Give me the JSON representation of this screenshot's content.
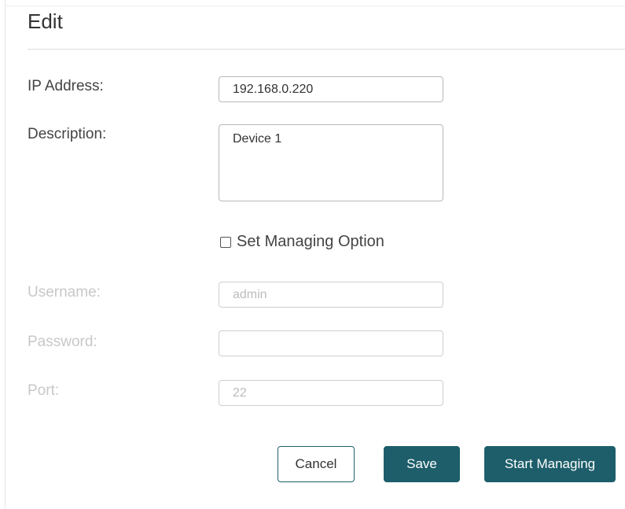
{
  "dialog": {
    "title": "Edit"
  },
  "form": {
    "ip_address": {
      "label": "IP Address:",
      "value": "192.168.0.220"
    },
    "description": {
      "label": "Description:",
      "value": "Device 1"
    },
    "managing_option": {
      "label": "Set Managing Option",
      "checked": false
    },
    "username": {
      "label": "Username:",
      "value": "admin",
      "disabled": true
    },
    "password": {
      "label": "Password:",
      "value": "",
      "disabled": true
    },
    "port": {
      "label": "Port:",
      "value": "22",
      "disabled": true
    }
  },
  "actions": {
    "cancel_label": "Cancel",
    "save_label": "Save",
    "start_managing_label": "Start Managing"
  },
  "colors": {
    "primary_button": "#1d5e6a",
    "disabled_text": "#c8c8c8"
  }
}
